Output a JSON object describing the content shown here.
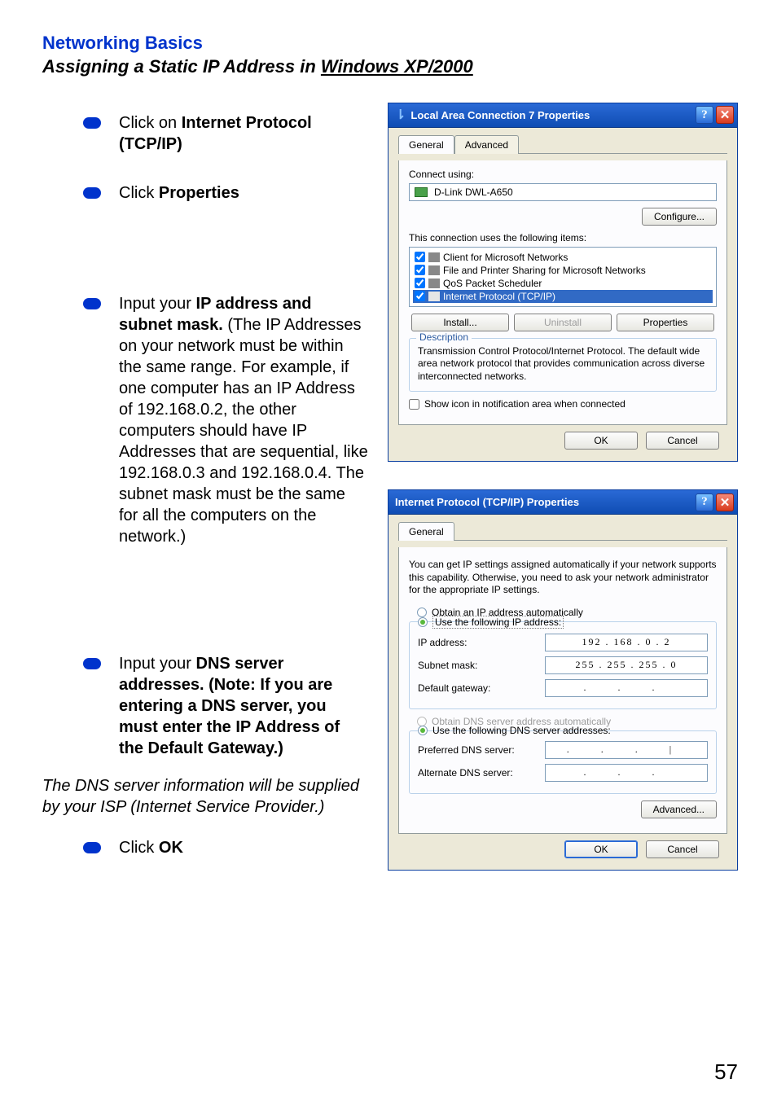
{
  "heading": "Networking Basics",
  "subheading_prefix": "Assigning a Static IP Address in ",
  "subheading_underlined": "Windows XP/2000",
  "bullets": {
    "b1_pre": "Click on ",
    "b1_bold": "Internet Protocol (TCP/IP)",
    "b2_pre": "Click ",
    "b2_bold": "Properties",
    "b3_pre": "Input your ",
    "b3_bold": "IP address and subnet mask.",
    "b3_post": " (The IP Addresses on your network must be within the same range. For example, if one computer has an IP Address of 192.168.0.2, the other computers should have IP Addresses that are sequential, like 192.168.0.3 and 192.168.0.4. The subnet mask must be the same for all the computers on the network.)",
    "b4_pre": "Input your ",
    "b4_bold": "DNS server addresses. (Note:  If you are entering a DNS server, you must enter the IP Address of the Default Gateway.)",
    "b5_pre": "Click ",
    "b5_bold": "OK"
  },
  "italic_note": "The DNS server information will be supplied by your ISP (Internet Service Provider.)",
  "dialog1": {
    "title": "Local Area Connection 7 Properties",
    "tab_general": "General",
    "tab_advanced": "Advanced",
    "connect_using_label": "Connect using:",
    "nic_name": "D-Link DWL-A650",
    "configure_btn": "Configure...",
    "items_label": "This connection uses the following items:",
    "items": {
      "i0": "Client for Microsoft Networks",
      "i1": "File and Printer Sharing for Microsoft Networks",
      "i2": "QoS Packet Scheduler",
      "i3": "Internet Protocol (TCP/IP)"
    },
    "install_btn": "Install...",
    "uninstall_btn": "Uninstall",
    "properties_btn": "Properties",
    "desc_title": "Description",
    "desc_text": "Transmission Control Protocol/Internet Protocol. The default wide area network protocol that provides communication across diverse interconnected networks.",
    "show_icon": "Show icon in notification area when connected",
    "ok": "OK",
    "cancel": "Cancel"
  },
  "dialog2": {
    "title": "Internet Protocol (TCP/IP) Properties",
    "tab_general": "General",
    "info": "You can get IP settings assigned automatically if your network supports this capability. Otherwise, you need to ask your network administrator for the appropriate IP settings.",
    "radio_auto_ip": "Obtain an IP address automatically",
    "radio_use_ip": "Use the following IP address:",
    "ip_label": "IP address:",
    "ip_value": "192 . 168 .   0  .   2",
    "subnet_label": "Subnet mask:",
    "subnet_value": "255 . 255 . 255 .   0",
    "gateway_label": "Default gateway:",
    "gateway_value": ".        .        .",
    "radio_auto_dns": "Obtain DNS server address automatically",
    "radio_use_dns": "Use the following DNS server addresses:",
    "pref_dns_label": "Preferred DNS server:",
    "pref_dns_value": ".        .        .  |",
    "alt_dns_label": "Alternate DNS server:",
    "alt_dns_value": ".        .        .",
    "advanced_btn": "Advanced...",
    "ok": "OK",
    "cancel": "Cancel"
  },
  "page_number": "57"
}
